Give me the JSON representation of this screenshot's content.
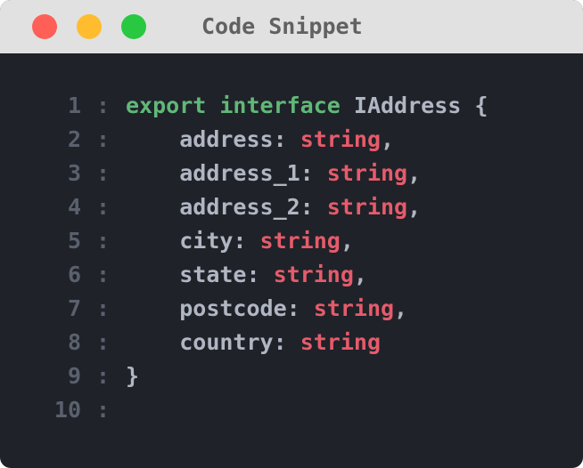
{
  "window": {
    "title": "Code Snippet",
    "titlebar_color": "#e1e1e1",
    "background_color": "#1f2229",
    "controls": [
      {
        "name": "close",
        "color": "#fe5f57"
      },
      {
        "name": "minimize",
        "color": "#febc2e"
      },
      {
        "name": "maximize",
        "color": "#28c840"
      }
    ]
  },
  "code": {
    "separator": ":",
    "colors": {
      "keyword": "#61b878",
      "type": "#e65b6b",
      "plain": "#b0b6c2",
      "line_number": "#5a616d"
    },
    "lines": [
      {
        "num": "1",
        "indent": "",
        "tokens": [
          {
            "t": "export",
            "k": "keyword"
          },
          {
            "t": " ",
            "k": "plain"
          },
          {
            "t": "interface",
            "k": "keyword"
          },
          {
            "t": " IAddress {",
            "k": "plain"
          }
        ]
      },
      {
        "num": "2",
        "indent": "    ",
        "tokens": [
          {
            "t": "address: ",
            "k": "plain"
          },
          {
            "t": "string",
            "k": "type"
          },
          {
            "t": ",",
            "k": "plain"
          }
        ]
      },
      {
        "num": "3",
        "indent": "    ",
        "tokens": [
          {
            "t": "address_1: ",
            "k": "plain"
          },
          {
            "t": "string",
            "k": "type"
          },
          {
            "t": ",",
            "k": "plain"
          }
        ]
      },
      {
        "num": "4",
        "indent": "    ",
        "tokens": [
          {
            "t": "address_2: ",
            "k": "plain"
          },
          {
            "t": "string",
            "k": "type"
          },
          {
            "t": ",",
            "k": "plain"
          }
        ]
      },
      {
        "num": "5",
        "indent": "    ",
        "tokens": [
          {
            "t": "city: ",
            "k": "plain"
          },
          {
            "t": "string",
            "k": "type"
          },
          {
            "t": ",",
            "k": "plain"
          }
        ]
      },
      {
        "num": "6",
        "indent": "    ",
        "tokens": [
          {
            "t": "state: ",
            "k": "plain"
          },
          {
            "t": "string",
            "k": "type"
          },
          {
            "t": ",",
            "k": "plain"
          }
        ]
      },
      {
        "num": "7",
        "indent": "    ",
        "tokens": [
          {
            "t": "postcode: ",
            "k": "plain"
          },
          {
            "t": "string",
            "k": "type"
          },
          {
            "t": ",",
            "k": "plain"
          }
        ]
      },
      {
        "num": "8",
        "indent": "    ",
        "tokens": [
          {
            "t": "country: ",
            "k": "plain"
          },
          {
            "t": "string",
            "k": "type"
          }
        ]
      },
      {
        "num": "9",
        "indent": "",
        "tokens": [
          {
            "t": "}",
            "k": "plain"
          }
        ]
      },
      {
        "num": "10",
        "indent": "",
        "tokens": []
      }
    ]
  }
}
